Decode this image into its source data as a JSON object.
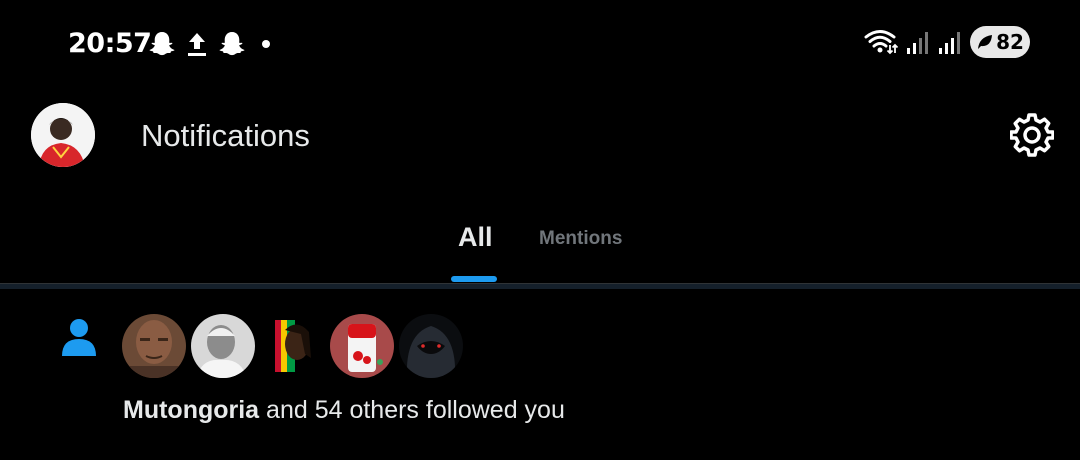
{
  "status_bar": {
    "time": "20:57",
    "battery": "82",
    "icons_left": [
      "snapchat-icon",
      "upload-icon",
      "snapchat-icon",
      "dot-icon"
    ],
    "icons_right": [
      "wifi-icon",
      "signal-icon",
      "signal-icon",
      "battery-icon"
    ]
  },
  "header": {
    "title": "Notifications",
    "icons": [
      "avatar",
      "settings-icon"
    ]
  },
  "tabs": [
    {
      "label": "All",
      "active": true
    },
    {
      "label": "Mentions",
      "active": false
    }
  ],
  "notification": {
    "icon": "person-icon",
    "user": "Mutongoria",
    "rest": " and 54 others followed you",
    "avatar_count": 5
  },
  "colors": {
    "background": "#000000",
    "accent": "#1d9bf0",
    "text_primary": "#e7e9ea",
    "text_secondary": "#71767b"
  }
}
